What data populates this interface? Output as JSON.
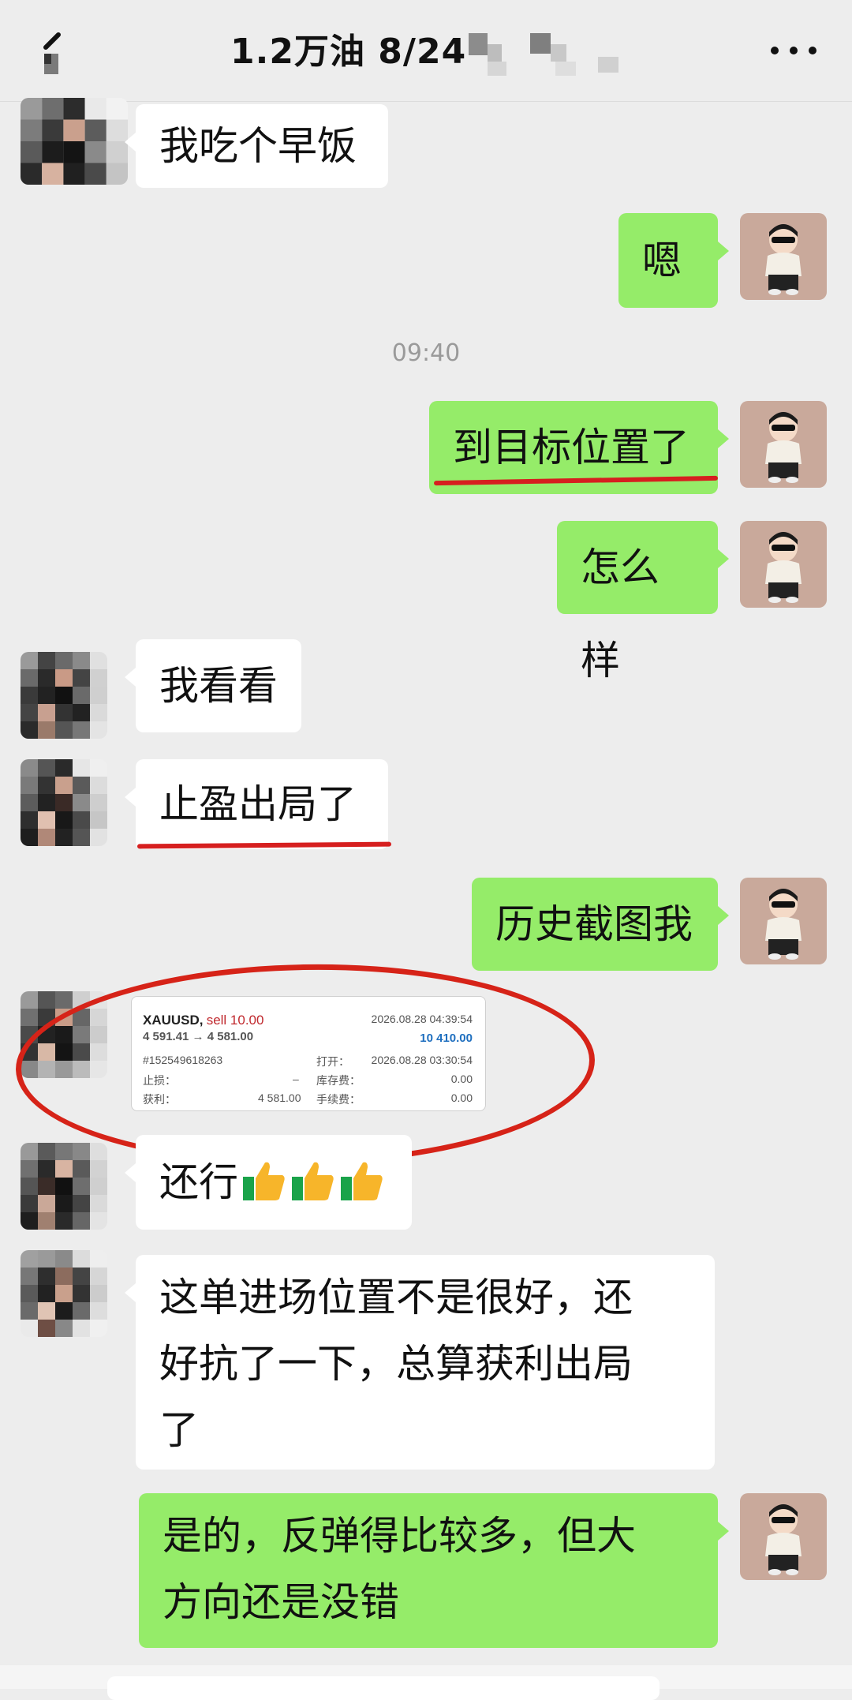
{
  "header": {
    "title": "1.2万油  8/24",
    "back_icon": "chevron-left-icon",
    "more_icon": "more-horizontal-icon"
  },
  "messages": [
    {
      "side": "left",
      "text": "我吃个早饭"
    },
    {
      "side": "right",
      "text": "嗯"
    },
    {
      "side": "time",
      "text": "09:40"
    },
    {
      "side": "right",
      "text": "到目标位置了",
      "underlined": true
    },
    {
      "side": "right",
      "text": "怎么样"
    },
    {
      "side": "left",
      "text": "我看看"
    },
    {
      "side": "left",
      "text": "止盈出局了",
      "underlined": true
    },
    {
      "side": "right",
      "text": "历史截图我"
    },
    {
      "side": "left",
      "type": "image",
      "circled": true
    },
    {
      "side": "left",
      "text": "还行",
      "emoji": "thumbs-up-icon x3"
    },
    {
      "side": "left",
      "text": "这单进场位置不是很好，还好抗了一下，总算获利出局了"
    },
    {
      "side": "right",
      "text": "是的，反弹得比较多，但大方向还是没错"
    }
  ],
  "m": {
    "m1": "我吃个早饭",
    "m2": "嗯",
    "time": "09:40",
    "m3": "到目标位置了",
    "m4": "怎么样",
    "m5": "我看看",
    "m6": "止盈出局了",
    "m7": "历史截图我",
    "m8": "还行",
    "m9_line1": "这单进场位置不是很好，还",
    "m9_line2": "好抗了一下，总算获利出局",
    "m9_line3": "了",
    "m10_line1": "是的，反弹得比较多，但大",
    "m10_line2": "方向还是没错"
  },
  "trade_card": {
    "symbol": "XAUUSD,",
    "side": "sell 10.00",
    "close_time": "2026.08.28 04:39:54",
    "prices": "4 591.41 → 4 581.00",
    "profit_value": "10 410.00",
    "order_id": "#152549618263",
    "open_label": "打开：",
    "open_time": "2026.08.28 03:30:54",
    "sl_label": "止损：",
    "sl_value": "–",
    "swap_label": "库存费：",
    "swap_value": "0.00",
    "tp_label": "获利：",
    "tp_value": "4 581.00",
    "fee_label": "手续费：",
    "fee_value": "0.00"
  },
  "colors": {
    "bg": "#ededed",
    "sent_bubble": "#95ec69",
    "received_bubble": "#ffffff",
    "annotation_red": "#d61f1f"
  }
}
